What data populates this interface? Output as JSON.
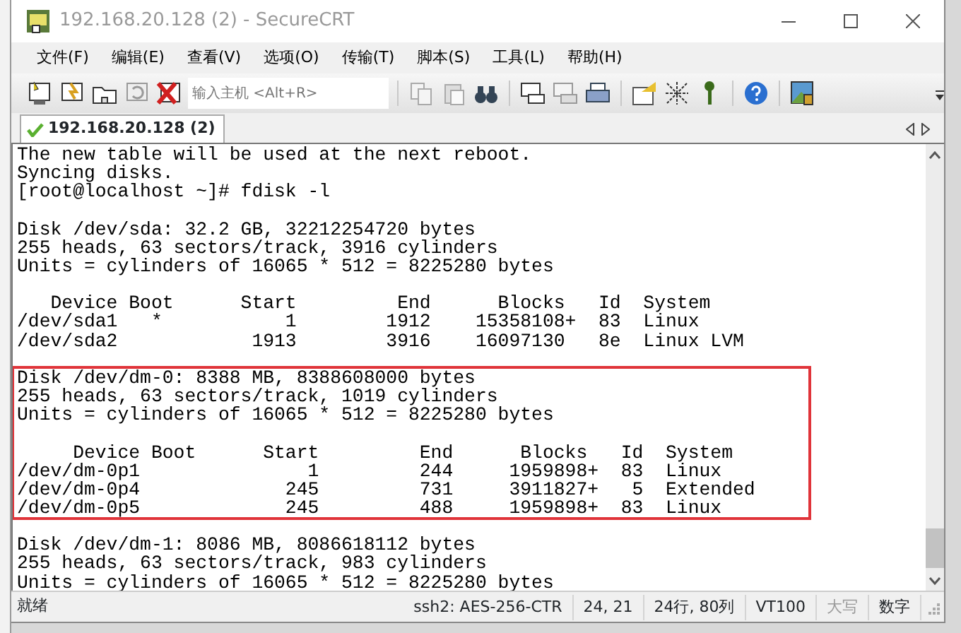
{
  "window": {
    "title": "192.168.20.128 (2) - SecureCRT"
  },
  "menu": [
    "文件(F)",
    "编辑(E)",
    "查看(V)",
    "选项(O)",
    "传输(T)",
    "脚本(S)",
    "工具(L)",
    "帮助(H)"
  ],
  "toolbar": {
    "host_field": {
      "placeholder": "输入主机 <Alt+R>"
    }
  },
  "tabs": [
    {
      "label": "192.168.20.128 (2)",
      "selected": true
    }
  ],
  "terminal": {
    "blocks": [
      {
        "highlighted": false,
        "lines": [
          "The new table will be used at the next reboot.",
          "Syncing disks.",
          "[root@localhost ~]# fdisk -l"
        ]
      },
      {
        "highlighted": false,
        "lines": [
          "Disk /dev/sda: 32.2 GB, 32212254720 bytes",
          "255 heads, 63 sectors/track, 3916 cylinders",
          "Units = cylinders of 16065 * 512 = 8225280 bytes"
        ]
      },
      {
        "highlighted": false,
        "lines": [
          "   Device Boot      Start         End      Blocks   Id  System",
          "/dev/sda1   *           1        1912    15358108+  83  Linux",
          "/dev/sda2            1913        3916    16097130   8e  Linux LVM"
        ]
      },
      {
        "highlighted": true,
        "lines": [
          "Disk /dev/dm-0: 8388 MB, 8388608000 bytes",
          "255 heads, 63 sectors/track, 1019 cylinders",
          "Units = cylinders of 16065 * 512 = 8225280 bytes"
        ]
      },
      {
        "highlighted": true,
        "lines": [
          "     Device Boot      Start         End      Blocks   Id  System",
          "/dev/dm-0p1               1         244     1959898+  83  Linux",
          "/dev/dm-0p4             245         731     3911827+   5  Extended",
          "/dev/dm-0p5             245         488     1959898+  83  Linux"
        ]
      },
      {
        "highlighted": false,
        "lines": [
          "Disk /dev/dm-1: 8086 MB, 8086618112 bytes",
          "255 heads, 63 sectors/track, 983 cylinders",
          "Units = cylinders of 16065 * 512 = 8225280 bytes"
        ]
      }
    ]
  },
  "status_bar": [
    {
      "text": "就绪",
      "kind": "message"
    },
    {
      "text": "ssh2: AES-256-CTR",
      "kind": "cell"
    },
    {
      "text": "24,  21",
      "kind": "cell"
    },
    {
      "text": "24行, 80列",
      "kind": "cell"
    },
    {
      "text": "VT100",
      "kind": "cell"
    },
    {
      "text": "大写",
      "kind": "indicator",
      "active": false
    },
    {
      "text": "数字",
      "kind": "indicator",
      "active": true
    }
  ]
}
